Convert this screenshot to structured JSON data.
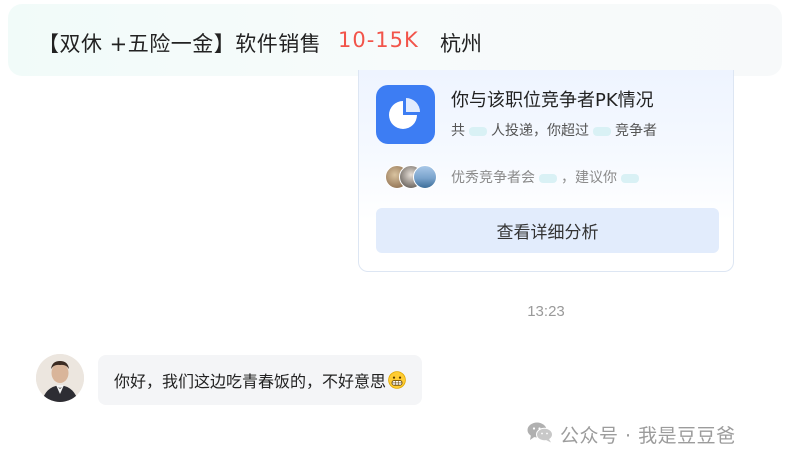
{
  "job": {
    "title": "【双休 +五险一金】软件销售",
    "salary": "10-15K",
    "city": "杭州"
  },
  "pk_card": {
    "title": "你与该职位竞争者PK情况",
    "stats": {
      "prefix": "共",
      "applied_suffix": "人投递，你超过",
      "competitor_suffix": "竞争者"
    },
    "advice": {
      "prefix": "优秀竞争者会",
      "middle": "，建议你"
    },
    "button_label": "查看详细分析",
    "icon": "pie-chart-icon",
    "icon_color": "#3d7df3"
  },
  "timestamp": "13:23",
  "message": {
    "text": "你好，我们这边吃青春饭的，不好意思",
    "emoji": "grimacing-emoji"
  },
  "watermark": {
    "text": "公众号 · 我是豆豆爸",
    "icon": "wechat-icon"
  },
  "colors": {
    "salary": "#f2544a",
    "accent": "#3d7df3",
    "button_bg": "#e2ecfc"
  }
}
